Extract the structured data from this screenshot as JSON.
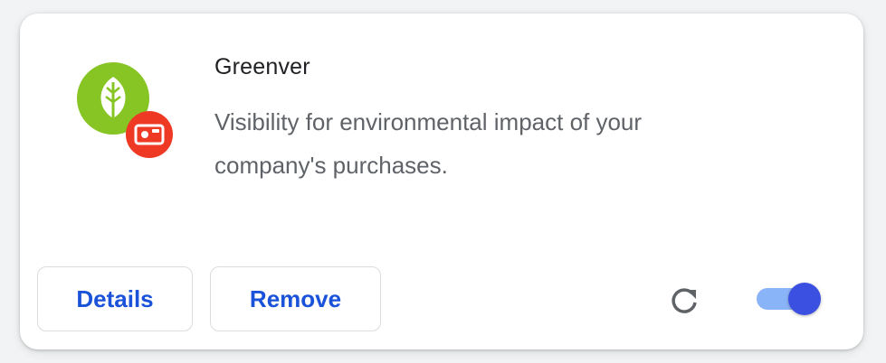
{
  "extension": {
    "name": "Greenver",
    "description": "Visibility for environmental impact of your company's purchases.",
    "logo_icon": "leaf-icon",
    "badge_icon": "camera-badge-icon",
    "enabled": true
  },
  "actions": {
    "details_label": "Details",
    "remove_label": "Remove",
    "reload_icon": "reload-icon"
  },
  "colors": {
    "accent": "#1a52d9",
    "toggle_on": "#3b4fe0",
    "toggle_track": "#8ab4f8",
    "logo_green": "#86c523",
    "badge_red": "#ee3a24"
  }
}
